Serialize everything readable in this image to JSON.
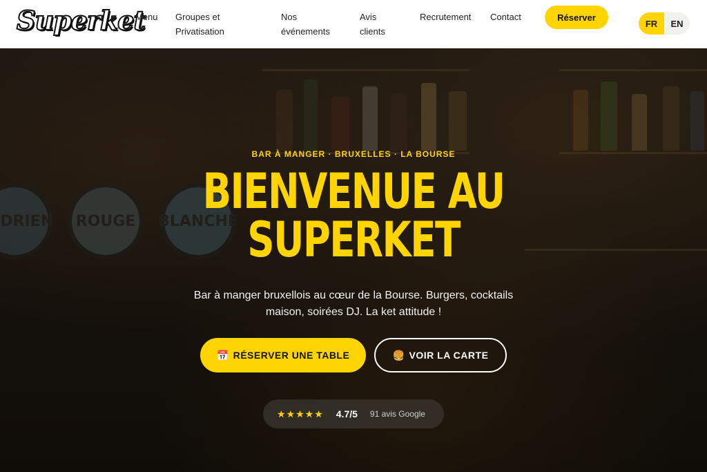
{
  "header": {
    "logo_text": "Superket",
    "nav": [
      {
        "label": "Menu"
      },
      {
        "label": "Groupes et Privatisation"
      },
      {
        "label": "Nos événements"
      },
      {
        "label": "Avis clients"
      },
      {
        "label": "Recrutement"
      },
      {
        "label": "Contact"
      }
    ],
    "reserve_label": "Réserver",
    "languages": {
      "fr": "FR",
      "en": "EN",
      "active": "FR"
    }
  },
  "hero": {
    "eyebrow": "BAR À MANGER · BRUXELLES · LA BOURSE",
    "title_line1": "BIENVENUE AU",
    "title_line2": "SUPERKET",
    "subtitle": "Bar à manger bruxellois au cœur de la Bourse. Burgers, cocktails maison, soirées DJ. La ket attitude !",
    "primary_cta": {
      "icon": "📅",
      "label": "RÉSERVER UNE TABLE"
    },
    "secondary_cta": {
      "icon": "🍔",
      "label": "VOIR LA CARTE"
    },
    "rating": {
      "stars": "★★★★★",
      "score": "4.7/5",
      "reviews": "91 avis Google"
    },
    "tap_labels": [
      "ANDRIEN",
      "ROUGE",
      "BLANCHE"
    ]
  },
  "colors": {
    "accent": "#ffd400",
    "header_bg": "#ffffff",
    "hero_bg": "#1f1812"
  }
}
